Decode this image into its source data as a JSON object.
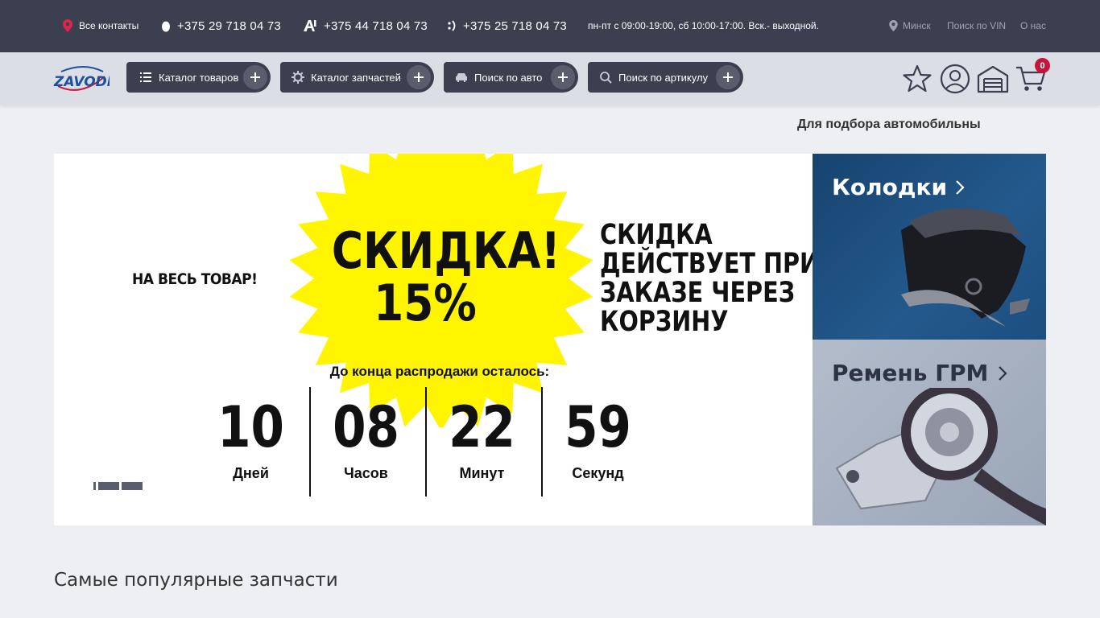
{
  "topbar": {
    "contacts_label": "Все контакты",
    "phone1": "+375 29 718 04 73",
    "phone2": "+375 44 718 04 73",
    "phone3": "+375 25 718 04 73",
    "hours": "пн-пт с 09:00-19:00, сб 10:00-17:00. Вск.- выходной.",
    "city": "Минск",
    "vin_search": "Поиск по VIN",
    "about": "О нас",
    "colors": {
      "bar": "#3c3f50",
      "accent": "#e2244a"
    }
  },
  "nav": {
    "logo_text": "ZAVODI",
    "buttons": [
      {
        "label": "Каталог товаров",
        "icon": "list-icon"
      },
      {
        "label": "Каталог запчастей",
        "icon": "gear-icon"
      },
      {
        "label": "Поиск по авто",
        "icon": "car-icon"
      },
      {
        "label": "Поиск по артикулу",
        "icon": "search-icon"
      }
    ],
    "icons": [
      "star-icon",
      "user-icon",
      "garage-icon",
      "cart-icon"
    ],
    "cart_count": "0"
  },
  "ticker": "Для подбора автомобильны",
  "banner": {
    "left_text": "НА ВЕСЬ ТОВАР!",
    "headline": "СКИДКА!",
    "percent": "15%",
    "right_text_lines": [
      "СКИДКА",
      "ДЕЙСТВУЕТ ПРИ",
      "ЗАКАЗЕ ЧЕРЕЗ",
      "КОРЗИНУ"
    ],
    "countdown_label": "До конца распродажи осталось:",
    "countdown": [
      {
        "value": "10",
        "unit": "Дней"
      },
      {
        "value": "08",
        "unit": "Часов"
      },
      {
        "value": "22",
        "unit": "Минут"
      },
      {
        "value": "59",
        "unit": "Секунд"
      }
    ],
    "starburst_color": "#fff500"
  },
  "tiles": [
    {
      "title": "Колодки"
    },
    {
      "title": "Ремень ГРМ"
    }
  ],
  "section_title": "Самые популярные запчасти"
}
